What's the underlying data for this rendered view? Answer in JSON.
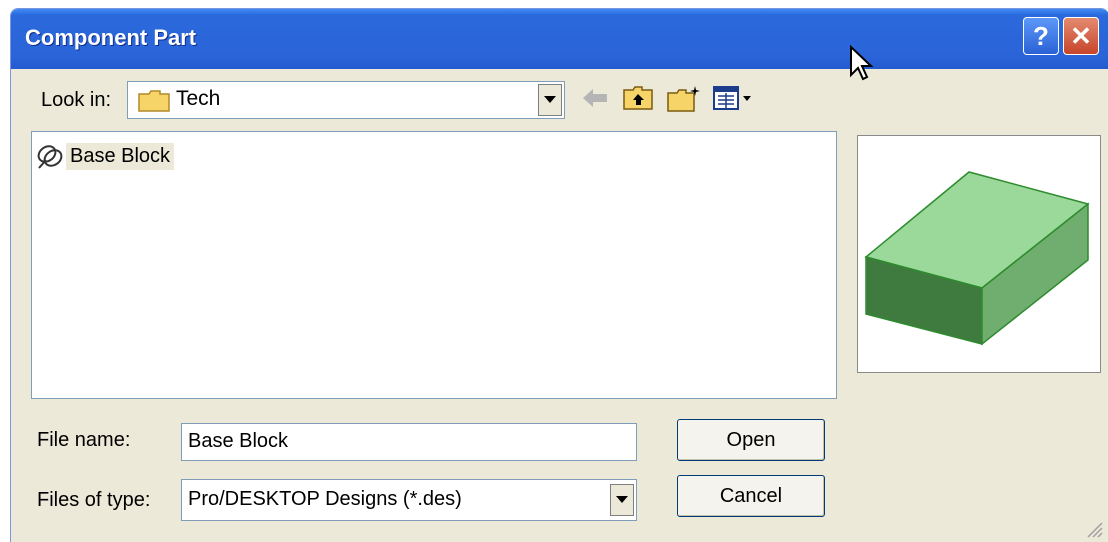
{
  "window": {
    "title": "Component Part",
    "help_label": "?",
    "close_label": "✕"
  },
  "look_in": {
    "label": "Look in:",
    "value": "Tech"
  },
  "toolbar": {
    "back_icon": "back-arrow-icon",
    "up_icon": "up-one-level-icon",
    "new_folder_icon": "new-folder-icon",
    "view_menu_icon": "view-menu-icon"
  },
  "file_list": {
    "items": [
      {
        "name": "Base Block",
        "icon": "design-file-icon",
        "selected": true
      }
    ]
  },
  "file_name": {
    "label": "File name:",
    "value": "Base Block"
  },
  "file_type": {
    "label": "Files of type:",
    "value": "Pro/DESKTOP Designs (*.des)"
  },
  "buttons": {
    "open_label": "Open",
    "cancel_label": "Cancel"
  },
  "colors": {
    "titlebar": "#2a64d8",
    "dialog_bg": "#ece9d8",
    "preview_block": "#8fd68f"
  }
}
